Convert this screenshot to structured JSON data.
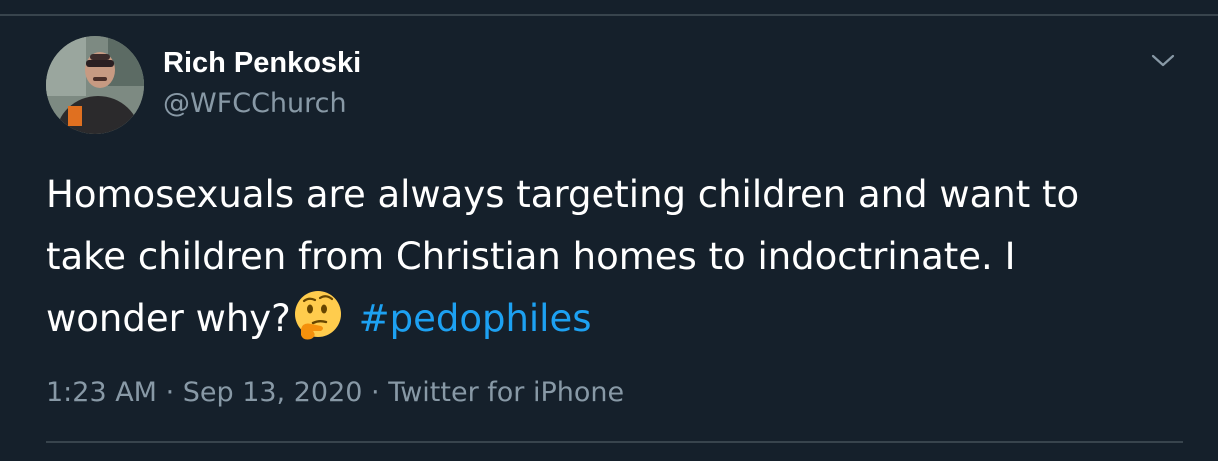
{
  "tweet": {
    "author": {
      "display_name": "Rich Penkoski",
      "handle": "@WFCChurch"
    },
    "text_line1": "Homosexuals are always targeting children and want to",
    "text_line2": "take children from Christian homes to indoctrinate. I",
    "text_line3_prefix": "wonder why?",
    "emoji": "thinking-face",
    "hashtag": "#pedophiles",
    "time": "1:23 AM",
    "separator": " · ",
    "date": "Sep 13, 2020",
    "source": "Twitter for iPhone"
  },
  "icons": {
    "more": "chevron-down-icon"
  },
  "colors": {
    "background": "#15202b",
    "border": "#38444d",
    "secondary_text": "#8899a6",
    "link": "#1da1f2"
  }
}
